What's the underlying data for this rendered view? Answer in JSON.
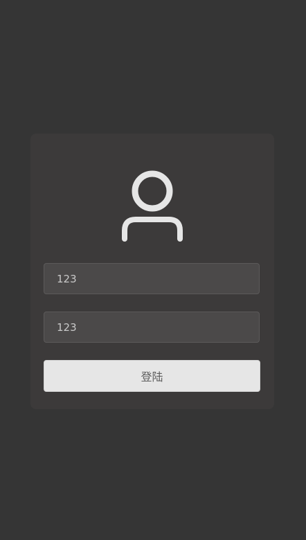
{
  "login": {
    "username_value": "123",
    "password_value": "123",
    "submit_label": "登陆"
  },
  "icons": {
    "avatar": "user-outline-icon"
  },
  "colors": {
    "background": "#353535",
    "card": "#3c3a3a",
    "input_fill": "#4b4949",
    "button_fill": "#e6e6e6",
    "icon_stroke": "#e6e6e6"
  }
}
